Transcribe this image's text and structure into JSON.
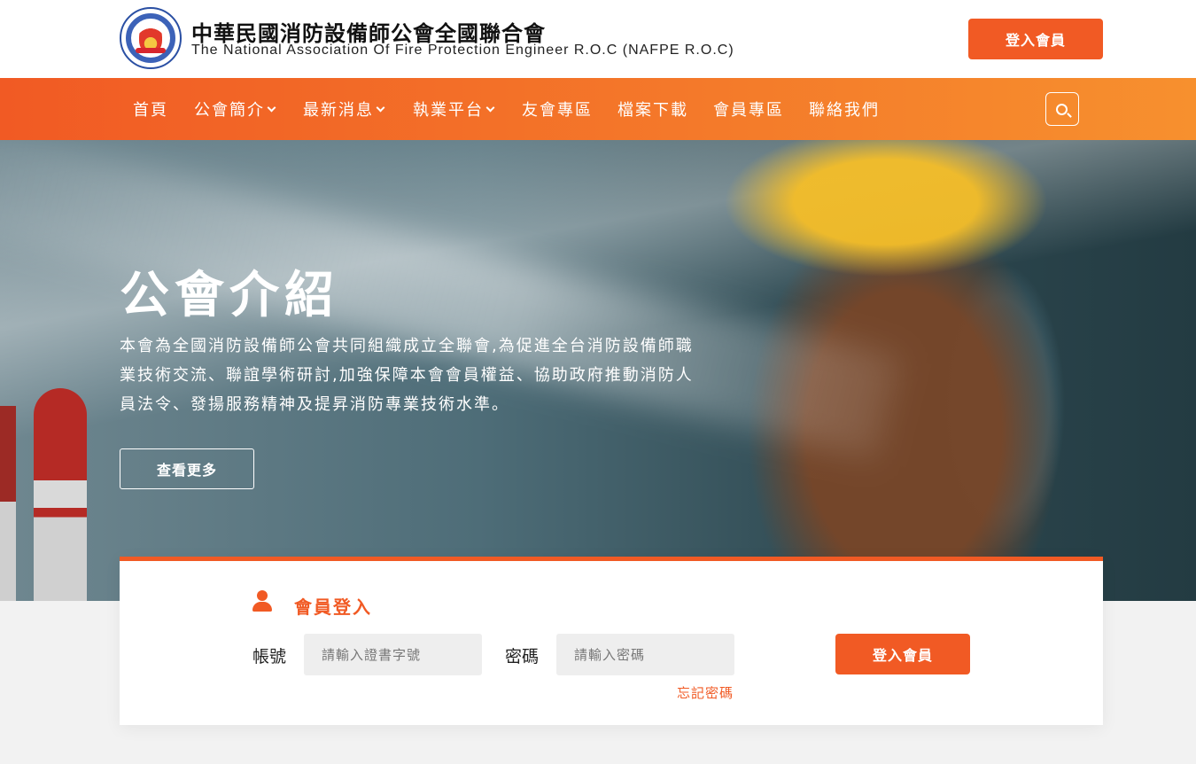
{
  "header": {
    "title": "中華民國消防設備師公會全國聯合會",
    "subtitle": "The National Association Of Fire Protection Engineer R.O.C (NAFPE R.O.C)",
    "login_label": "登入會員"
  },
  "nav": {
    "items": [
      {
        "label": "首頁",
        "dropdown": false
      },
      {
        "label": "公會簡介",
        "dropdown": true
      },
      {
        "label": "最新消息",
        "dropdown": true
      },
      {
        "label": "執業平台",
        "dropdown": true
      },
      {
        "label": "友會專區",
        "dropdown": false
      },
      {
        "label": "檔案下載",
        "dropdown": false
      },
      {
        "label": "會員專區",
        "dropdown": false
      },
      {
        "label": "聯絡我們",
        "dropdown": false
      }
    ],
    "search_icon": "search-icon"
  },
  "hero": {
    "title": "公會介紹",
    "text": "本會為全國消防設備師公會共同組織成立全聯會,為促進全台消防設備師職業技術交流、聯誼學術研討,加強保障本會會員權益、協助政府推動消防人員法令、發揚服務精神及提昇消防專業技術水準。",
    "more_label": "查看更多"
  },
  "login_panel": {
    "title": "會員登入",
    "account_label": "帳號",
    "account_placeholder": "請輸入證書字號",
    "password_label": "密碼",
    "password_placeholder": "請輸入密碼",
    "forgot_label": "忘記密碼",
    "submit_label": "登入會員"
  },
  "colors": {
    "accent": "#f15a24",
    "nav_gradient_end": "#f7902e"
  }
}
